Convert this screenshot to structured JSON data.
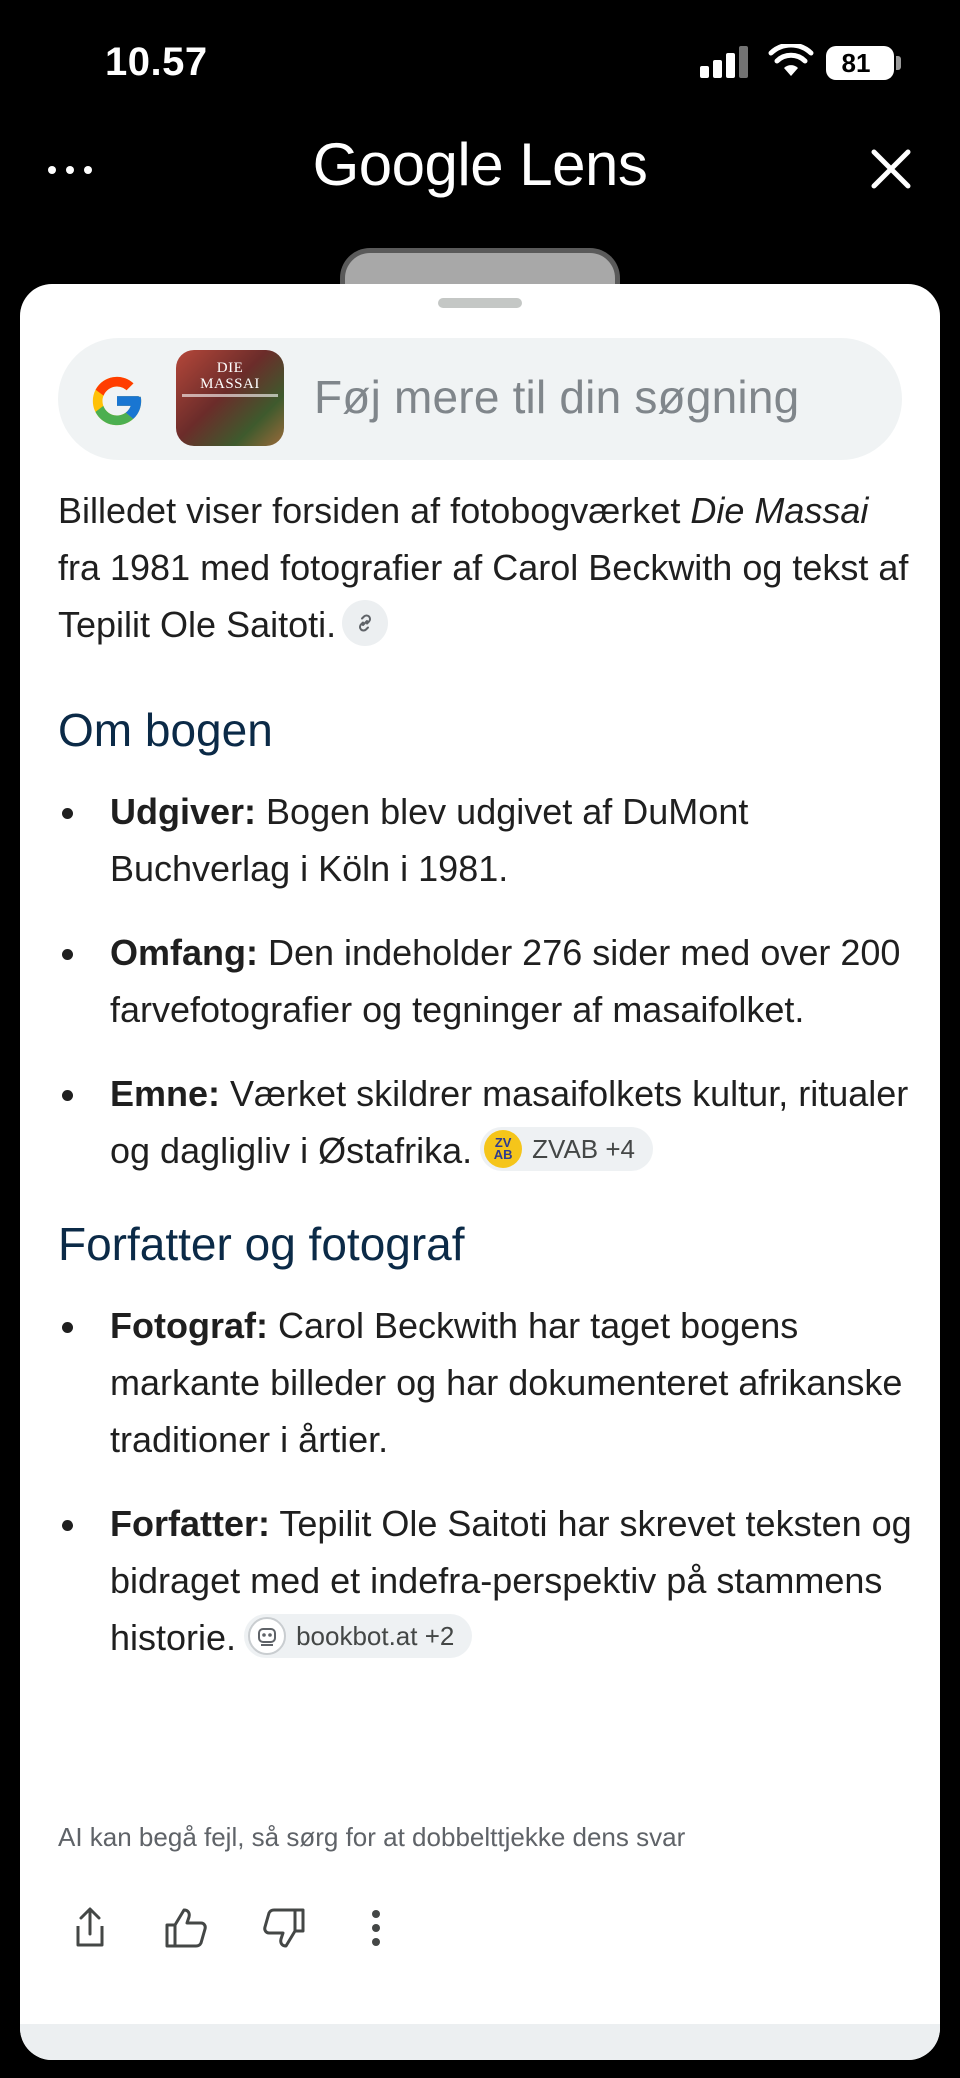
{
  "status": {
    "time": "10.57",
    "battery": "81"
  },
  "header": {
    "title": "Google Lens"
  },
  "search": {
    "placeholder": "Føj mere til din søgning",
    "thumb_title_line1": "DIE",
    "thumb_title_line2": "MASSAI"
  },
  "answer": {
    "intro_before": "Billedet viser forsiden af fotobogværket ",
    "intro_title": "Die Massai",
    "intro_after": " fra 1981 med fotografier af Carol Beckwith og tekst af Tepilit Ole Saitoti.",
    "sections": [
      {
        "heading": "Om bogen",
        "items": [
          {
            "label": "Udgiver:",
            "text": " Bogen blev udgivet af DuMont Buchverlag i Köln i 1981."
          },
          {
            "label": "Omfang:",
            "text": " Den indeholder 276 sider med over 200 farvefotografier og tegninger af masaifolket."
          },
          {
            "label": "Emne:",
            "text": " Værket skildrer masaifolkets kultur, ritualer og dagligliv i Østafrika.",
            "source": "ZVAB +4",
            "source_icon_text": "ZV AB"
          }
        ]
      },
      {
        "heading": "Forfatter og fotograf",
        "items": [
          {
            "label": "Fotograf:",
            "text": " Carol Beckwith har taget bogens markante billeder og har dokumenteret afrikanske traditioner i årtier."
          },
          {
            "label": "Forfatter:",
            "text": " Tepilit Ole Saitoti har skrevet teksten og bidraget med et indefra-perspektiv på stammens historie.",
            "source": "bookbot.at +2"
          }
        ]
      }
    ],
    "disclaimer": "AI kan begå fejl, så sørg for at dobbelttjekke dens svar"
  },
  "icons": {
    "share": "share-icon",
    "thumbs_up": "thumbs-up-icon",
    "thumbs_down": "thumbs-down-icon",
    "more": "more-vertical-icon"
  },
  "colors": {
    "heading": "#0b2a47",
    "background": "#000000",
    "sheet": "#ffffff",
    "pill": "#f0f3f4"
  }
}
